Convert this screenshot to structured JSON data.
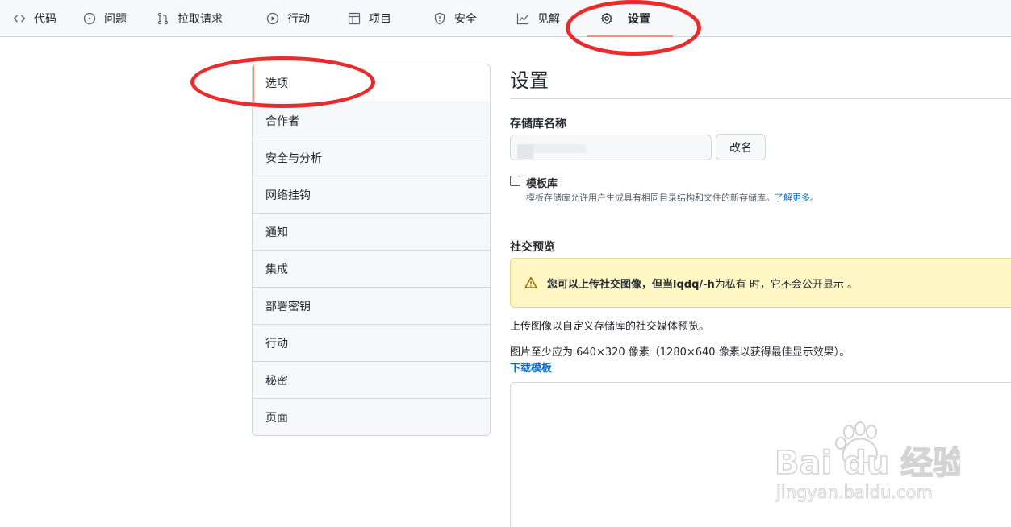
{
  "nav": {
    "tabs": [
      {
        "label": "代码",
        "icon": "code-icon"
      },
      {
        "label": "问题",
        "icon": "issue-icon"
      },
      {
        "label": "拉取请求",
        "icon": "pull-request-icon"
      },
      {
        "label": "行动",
        "icon": "play-icon"
      },
      {
        "label": "项目",
        "icon": "table-icon"
      },
      {
        "label": "安全",
        "icon": "shield-icon"
      },
      {
        "label": "见解",
        "icon": "graph-icon"
      },
      {
        "label": "设置",
        "icon": "gear-icon",
        "active": true
      }
    ]
  },
  "sidebar": {
    "items": [
      {
        "label": "选项",
        "selected": true
      },
      {
        "label": "合作者"
      },
      {
        "label": "安全与分析"
      },
      {
        "label": "网络挂钩"
      },
      {
        "label": "通知"
      },
      {
        "label": "集成"
      },
      {
        "label": "部署密钥"
      },
      {
        "label": "行动"
      },
      {
        "label": "秘密"
      },
      {
        "label": "页面"
      }
    ]
  },
  "main": {
    "title": "设置",
    "repo_name_label": "存储库名称",
    "rename_button": "改名",
    "template": {
      "label": "模板库",
      "checked": false,
      "description": "模板存储库允许用户生成具有相同目录结构和文件的新存储库。",
      "learn_more": "了解更多",
      "period": "。"
    },
    "social_preview": {
      "label": "社交预览",
      "flash_bold": "您可以上传社交图像，但当lqdq/-h",
      "flash_rest": "为私有 时，它不会公开显示 。",
      "desc1": "上传图像以自定义存储库的社交媒体预览。",
      "desc2": "图片至少应为 640×320 像素（1280×640 像素以获得最佳显示效果）。",
      "download_link": "下载模板"
    }
  },
  "watermark": {
    "brand": "Bai du 经验",
    "url": "jingyan.baidu.com"
  },
  "colors": {
    "accent_underline": "#fd8c73",
    "link": "#0969da",
    "annotation": "#ea2b2b",
    "flash_bg": "#fff8c5"
  }
}
